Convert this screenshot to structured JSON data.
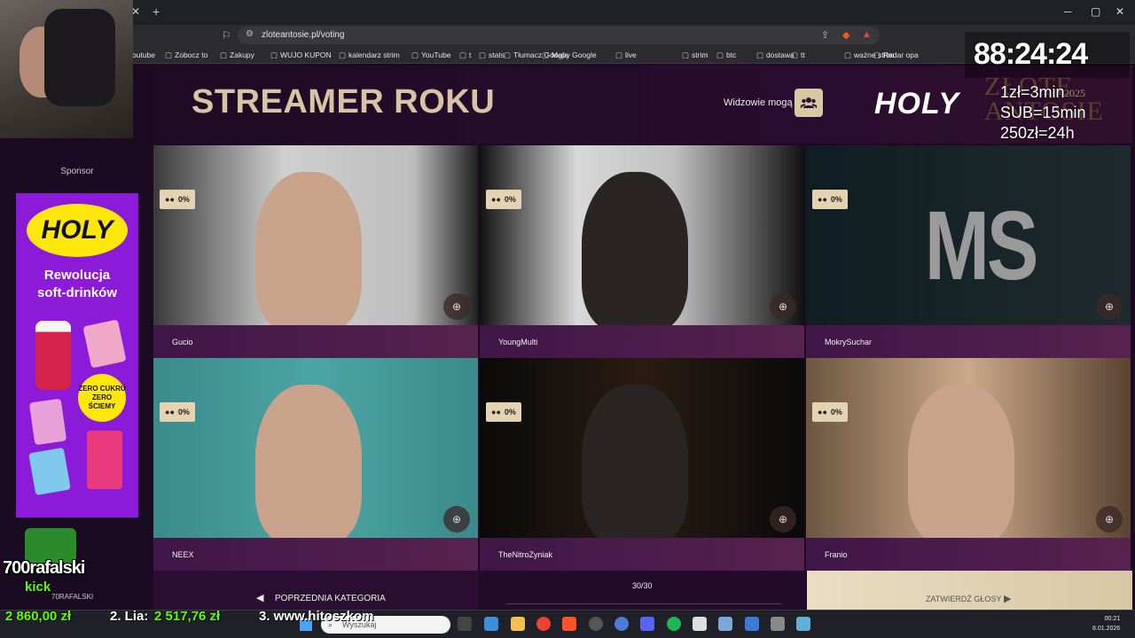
{
  "browser": {
    "url": "zloteantosie.pl/voting",
    "bookmarks": [
      "outube",
      "Zobocz to",
      "Zakupy",
      "WUJO KUPON",
      "kalendarz strim",
      "YouTube",
      "t",
      "stats",
      "Tłumacz Google",
      "Mapy Google",
      "live",
      "strim",
      "btc",
      "dostawa",
      "tt",
      "ważne strim",
      "Radar opa"
    ]
  },
  "page": {
    "title": "STREAMER ROKU",
    "viewers_label": "Widzowie mogą",
    "brand": "HOLY",
    "event_year": "2025",
    "sponsor_label": "Sponsor",
    "ad": {
      "brand": "HOLY",
      "line1": "Rewolucja",
      "line2": "soft-drinków",
      "badge": "ZERO CUKRU ZERO ŚCIEMY"
    }
  },
  "candidates": [
    {
      "name": "Gucio",
      "percent": "0%"
    },
    {
      "name": "YoungMulti",
      "percent": "0%"
    },
    {
      "name": "MokrySuchar",
      "percent": "0%",
      "initials": "MS"
    },
    {
      "name": "NEEX",
      "percent": "0%"
    },
    {
      "name": "TheNitroZyniak",
      "percent": "0%"
    },
    {
      "name": "Franio",
      "percent": "0%"
    }
  ],
  "footer": {
    "prev_label": "POPRZEDNIA KATEGORIA",
    "progress": "30/30",
    "progress_fraction": 1.0,
    "submit_label": "ZATWIERDŹ GŁOSY"
  },
  "overlay": {
    "timer": "88:24:24",
    "sub_lines": [
      "1zł=3min",
      "SUB=15min",
      "250zł=24h"
    ],
    "kick_name": "700rafalski",
    "kick_word": "kick",
    "kick_handle": "70RAFALSKI",
    "ticker": [
      {
        "text": "2 860,00 zł",
        "color": "#5dff00"
      },
      {
        "text": "2. Lia:",
        "color": "#ffffff"
      },
      {
        "text": "2 517,76 zł",
        "color": "#5dff00"
      },
      {
        "text": "3. www.hitoszkom",
        "color": "#ffffff"
      }
    ]
  },
  "taskbar": {
    "search_placeholder": "Wyszukaj",
    "time": "00:21",
    "date": "8.01.2026"
  }
}
